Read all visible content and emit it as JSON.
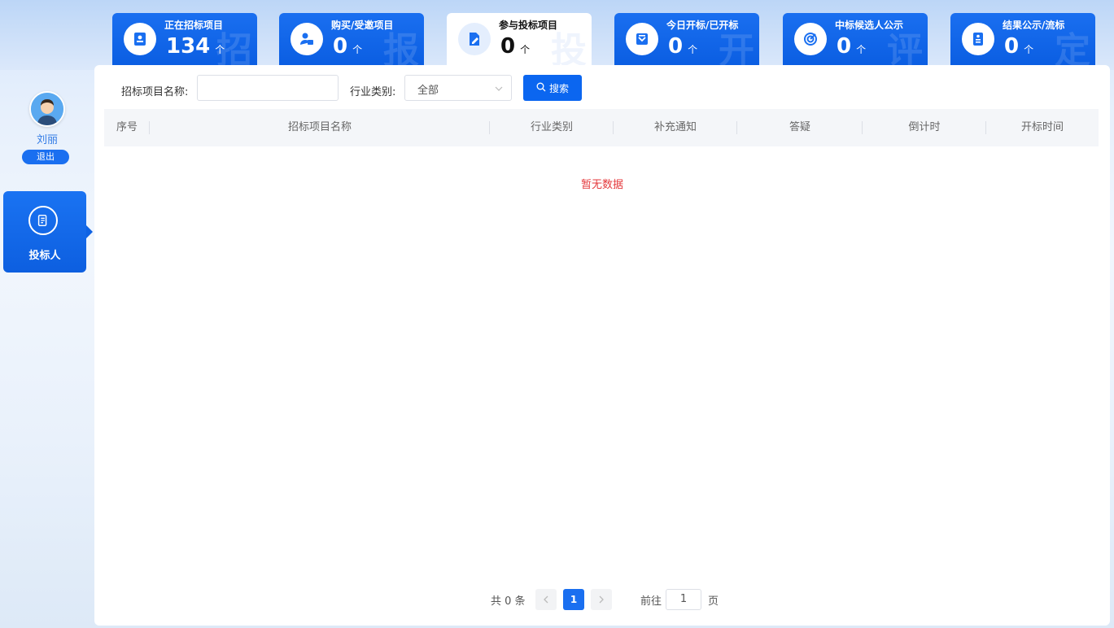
{
  "stats": [
    {
      "title": "正在招标项目",
      "count": "134",
      "unit": "个",
      "watermark": "招",
      "icon": "id-card-icon",
      "active": false
    },
    {
      "title": "购买/受邀项目",
      "count": "0",
      "unit": "个",
      "watermark": "报",
      "icon": "user-plus-icon",
      "active": false
    },
    {
      "title": "参与投标项目",
      "count": "0",
      "unit": "个",
      "watermark": "投",
      "icon": "edit-doc-icon",
      "active": true
    },
    {
      "title": "今日开标/已开标",
      "count": "0",
      "unit": "个",
      "watermark": "开",
      "icon": "envelope-open-icon",
      "active": false
    },
    {
      "title": "中标候选人公示",
      "count": "0",
      "unit": "个",
      "watermark": "评",
      "icon": "target-icon",
      "active": false
    },
    {
      "title": "结果公示/流标",
      "count": "0",
      "unit": "个",
      "watermark": "定",
      "icon": "certificate-icon",
      "active": false
    }
  ],
  "user": {
    "name": "刘丽",
    "logout": "退出"
  },
  "sidebar": {
    "items": [
      {
        "label": "投标人",
        "icon": "document-icon"
      }
    ]
  },
  "filters": {
    "name_label": "招标项目名称:",
    "name_value": "",
    "industry_label": "行业类别:",
    "industry_value": "全部",
    "search_label": "搜索"
  },
  "table": {
    "headers": [
      "序号",
      "招标项目名称",
      "行业类别",
      "补充通知",
      "答疑",
      "倒计时",
      "开标时间"
    ],
    "empty_text": "暂无数据"
  },
  "pagination": {
    "total_text": "共 0 条",
    "current_page": "1",
    "goto_label": "前往",
    "goto_value": "1",
    "page_suffix": "页"
  },
  "colors": {
    "primary": "#1a6ff0",
    "empty_text": "#e4393c",
    "header_bg": "#f4f6f9"
  }
}
